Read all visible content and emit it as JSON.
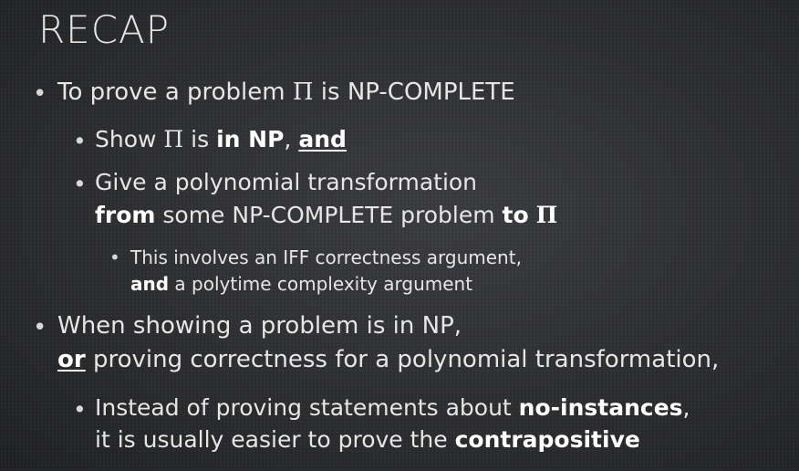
{
  "title": "RECAP",
  "b1": {
    "pre": "To prove a problem ",
    "pi": "Π",
    "post": " is NP-COMPLETE"
  },
  "b1a": {
    "pre": "Show ",
    "pi": "Π",
    "mid": " is ",
    "bold": "in NP",
    "comma": ", ",
    "and": "and"
  },
  "b1b": {
    "line1": "Give a polynomial transformation",
    "from": "from",
    "mid": " some NP-COMPLETE problem ",
    "to": "to",
    "pi": "Π"
  },
  "b1b1": {
    "line1": "This involves an IFF correctness argument,",
    "and": "and",
    "rest": " a polytime complexity argument"
  },
  "b2": {
    "line1": "When showing a problem is in NP,",
    "or": "or",
    "rest": " proving correctness for a polynomial transformation,"
  },
  "b2a": {
    "pre": "Instead of proving statements about ",
    "bold": "no-instances",
    "comma": ",",
    "line2": "it is usually easier to prove the ",
    "bold2": "contrapositive"
  }
}
